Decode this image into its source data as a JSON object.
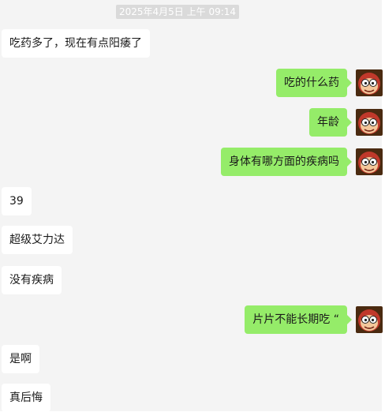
{
  "chat": {
    "timestamp": "2025年4月5日 上午 09:14",
    "messages": [
      {
        "side": "in",
        "text": "吃药多了，现在有点阳痿了"
      },
      {
        "side": "out",
        "text": "吃的什么药"
      },
      {
        "side": "out",
        "text": "年龄"
      },
      {
        "side": "out",
        "text": "身体有哪方面的疾病吗"
      },
      {
        "side": "in",
        "text": "39"
      },
      {
        "side": "in",
        "text": "超级艾力达"
      },
      {
        "side": "in",
        "text": "没有疾病"
      },
      {
        "side": "out",
        "text": "片片不能长期吃 “"
      },
      {
        "side": "in",
        "text": "是啊"
      },
      {
        "side": "in",
        "text": "真后悔"
      }
    ],
    "avatar_icon": "cartoon-monkey-avatar-icon",
    "colors": {
      "background": "#f4f4f4",
      "incoming_bubble": "#ffffff",
      "outgoing_bubble": "#95ec69",
      "timestamp_bg": "#dadada"
    }
  }
}
